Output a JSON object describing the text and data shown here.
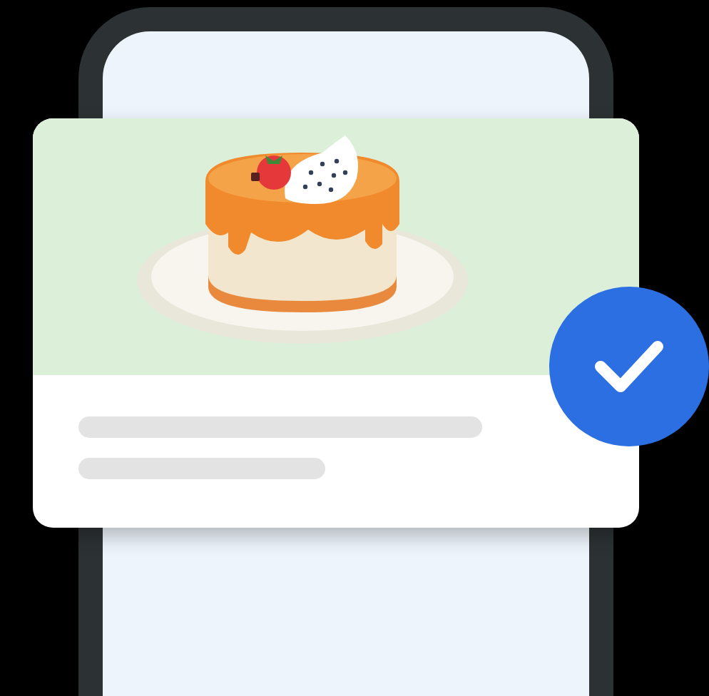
{
  "card": {
    "checked": true
  }
}
